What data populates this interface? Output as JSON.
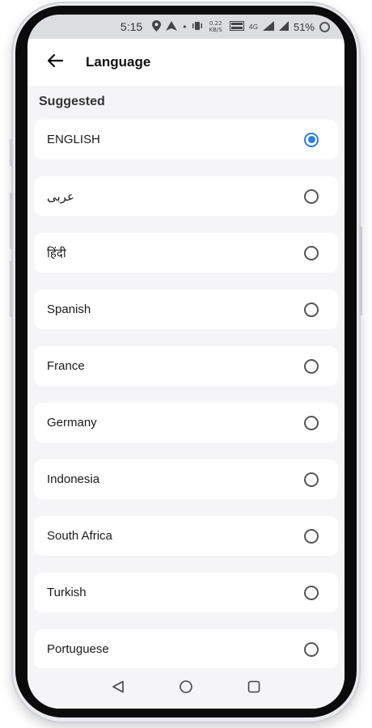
{
  "status_bar": {
    "time": "5:15",
    "net_speed": "0.22 KB/S",
    "network": "4G",
    "battery": "51%"
  },
  "header": {
    "title": "Language",
    "back_icon": "arrow-left-icon"
  },
  "section": {
    "label": "Suggested"
  },
  "languages": [
    {
      "label": "ENGLISH",
      "selected": true
    },
    {
      "label": "عربى",
      "selected": false
    },
    {
      "label": "हिंदी",
      "selected": false
    },
    {
      "label": "Spanish",
      "selected": false
    },
    {
      "label": "France",
      "selected": false
    },
    {
      "label": "Germany",
      "selected": false
    },
    {
      "label": "Indonesia",
      "selected": false
    },
    {
      "label": "South Africa",
      "selected": false
    },
    {
      "label": "Turkish",
      "selected": false
    },
    {
      "label": "Portuguese",
      "selected": false
    }
  ],
  "nav": {
    "back_icon": "triangle-back-icon",
    "home_icon": "circle-home-icon",
    "recents_icon": "square-recents-icon"
  },
  "colors": {
    "accent": "#2a7de1",
    "background": "#f5f5f7",
    "card": "#ffffff"
  }
}
